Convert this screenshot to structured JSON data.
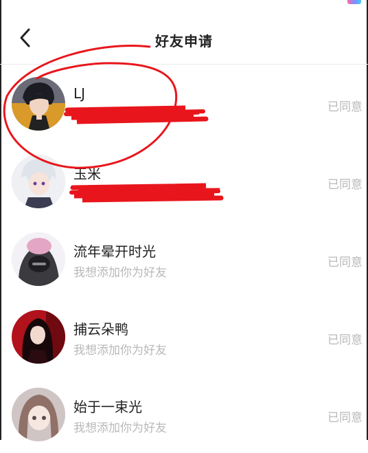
{
  "header": {
    "title": "好友申请",
    "back_icon": "chevron-left-icon"
  },
  "requests": [
    {
      "name": "LJ",
      "message": "",
      "status": "已同意",
      "avatar_theme": "boy-dark-hair"
    },
    {
      "name": "玉米",
      "message": "",
      "status": "已同意",
      "avatar_theme": "boy-white-hair"
    },
    {
      "name": "流年晕开时光",
      "message": "我想添加你为好友",
      "status": "已同意",
      "avatar_theme": "hooded-figure"
    },
    {
      "name": "捕云朵鸭",
      "message": "我想添加你为好友",
      "status": "已同意",
      "avatar_theme": "girl-red-background"
    },
    {
      "name": "始于一束光",
      "message": "我想添加你为好友",
      "status": "已同意",
      "avatar_theme": "girl-brown-hair"
    }
  ],
  "colors": {
    "name_text": "#222222",
    "subtext": "#b9b9b9",
    "status_text": "#b8b8b8",
    "annotation_red": "#e8161c"
  }
}
